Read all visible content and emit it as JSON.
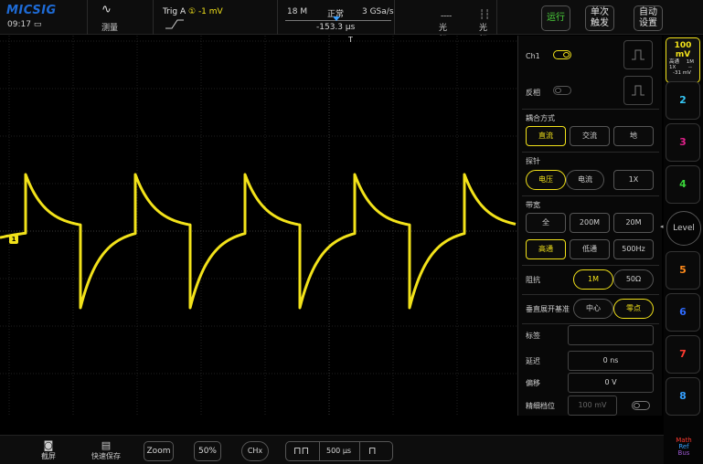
{
  "brand": "MICSIG",
  "status": {
    "time": "09:17"
  },
  "topbar": {
    "measure_label": "测量",
    "trigger": {
      "source": "Trig A",
      "channel": "①",
      "level": "-1 mV"
    },
    "acquisition": {
      "memory": "18 M",
      "mode": "正常",
      "sample_rate": "3 GSa/s",
      "position": "-153.3 µs"
    },
    "cursor1_label": "光标",
    "cursor2_label": "光标",
    "run_label": "运行",
    "single_label_1": "单次",
    "single_label_2": "触发",
    "auto_label_1": "自动",
    "auto_label_2": "设置"
  },
  "panel": {
    "ch1_label": "Ch1",
    "invert_label": "反相",
    "coupling_label": "耦合方式",
    "coupling_options": [
      "直流",
      "交流",
      "地"
    ],
    "coupling_selected": "直流",
    "probe_label": "探针",
    "probe_options": [
      "电压",
      "电流"
    ],
    "probe_selected": "电压",
    "probe_ratio": "1X",
    "bandwidth_label": "带宽",
    "bw_options": [
      "全",
      "200M",
      "20M"
    ],
    "filter_options": [
      "高通",
      "低通",
      "500Hz"
    ],
    "filter_selected": "高通",
    "impedance_label": "阻抗",
    "impedance_options": [
      "1M",
      "50Ω"
    ],
    "impedance_selected": "1M",
    "expand_label": "垂直展开基准",
    "expand_options": [
      "中心",
      "零点"
    ],
    "expand_selected": "零点",
    "tag_label": "标签",
    "tag_value": "",
    "delay_label": "延迟",
    "delay_value": "0 ns",
    "offset_label": "偏移",
    "offset_value": "0 V",
    "fine_label": "精细档位",
    "fine_value": "100 mV"
  },
  "channels": {
    "ch1": {
      "scale": "100 mV",
      "filter": "高通",
      "impedance": "1M",
      "probe": "1X",
      "coupling": "--",
      "offset": "-31 mV"
    },
    "list": [
      "2",
      "3",
      "4",
      "Level",
      "5",
      "6",
      "7",
      "8"
    ],
    "colors": {
      "ch1": "#f2e21a",
      "2": "#35c6f4",
      "3": "#e0218a",
      "4": "#3ad43a",
      "5": "#ff8a1a",
      "6": "#2f6bff",
      "7": "#ff3b30",
      "8": "#35a0ff"
    },
    "math_labels": [
      "Math",
      "Ref",
      "Bus"
    ]
  },
  "bottombar": {
    "screenshot_label": "截屏",
    "quicksave_label": "快速保存",
    "zoom_label": "Zoom",
    "percent_label": "50%",
    "chx_label": "CHx",
    "timebase": "500 µs"
  },
  "chart_data": {
    "type": "line",
    "series": [
      {
        "color": "#f2e21a",
        "description_points": "sawtooth-exponential waveform; 4 periods visible, falling exponential from high to midline then jump to bottom then rising exponential to midline"
      }
    ]
  },
  "colors": {
    "accent": "#f2e21a",
    "run": "#4cd43c",
    "trigger_marker": "#3aa0ff"
  }
}
